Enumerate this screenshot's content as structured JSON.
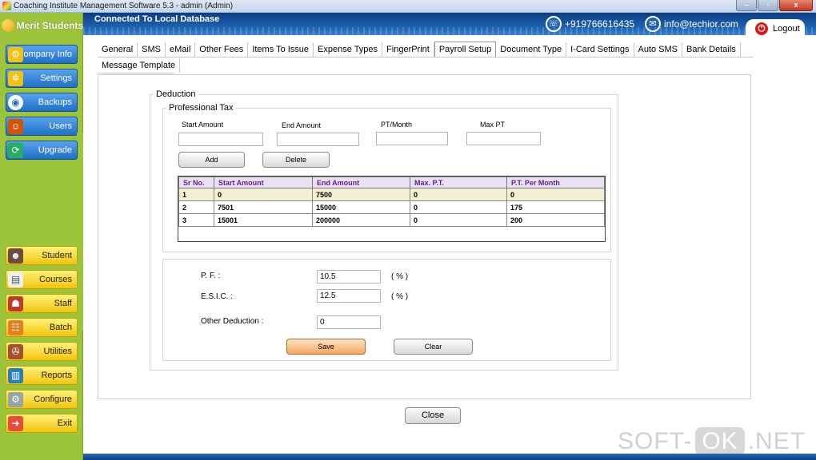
{
  "window": {
    "title": "Coaching Institute Management Software 5.3  -  admin (Admin)",
    "minimize": "–",
    "maximize": "▫",
    "close": "x"
  },
  "header": {
    "db_status": "Connected To  Local Database",
    "phone": "+919766616435",
    "email": "info@techior.com",
    "logout_label": "Logout"
  },
  "sidebar": {
    "brand": "Merit Students",
    "top_items": [
      {
        "label": "Company Info",
        "icon": "gear-icon"
      },
      {
        "label": "Settings",
        "icon": "settings-icon"
      },
      {
        "label": "Backups",
        "icon": "disk-icon"
      },
      {
        "label": "Users",
        "icon": "users-icon"
      },
      {
        "label": "Upgrade",
        "icon": "upgrade-icon"
      }
    ],
    "bottom_items": [
      {
        "label": "Student",
        "icon": "student-icon"
      },
      {
        "label": "Courses",
        "icon": "courses-icon"
      },
      {
        "label": "Staff",
        "icon": "staff-icon"
      },
      {
        "label": "Batch",
        "icon": "batch-icon"
      },
      {
        "label": "Utilities",
        "icon": "utilities-icon"
      },
      {
        "label": "Reports",
        "icon": "reports-icon"
      },
      {
        "label": "Configure",
        "icon": "configure-icon"
      },
      {
        "label": "Exit",
        "icon": "exit-icon"
      }
    ]
  },
  "tabs": {
    "row1": [
      "General",
      "SMS",
      "eMail",
      "Other Fees",
      "Items To Issue",
      "Expense Types",
      "FingerPrint",
      "Payroll Setup",
      "Document Type",
      "I-Card Settings",
      "Auto SMS",
      "Bank Details"
    ],
    "row2": [
      "Message Template"
    ],
    "active": "Payroll Setup"
  },
  "deduction": {
    "legend": "Deduction",
    "professional_tax": {
      "legend": "Professional Tax",
      "start_amount_label": "Start Amount",
      "end_amount_label": "End Amount",
      "pt_month_label": "PT/Month",
      "max_pt_label": "Max PT",
      "start_amount_value": "",
      "end_amount_value": "",
      "pt_month_value": "",
      "max_pt_value": "",
      "add_label": "Add",
      "delete_label": "Delete"
    },
    "table": {
      "columns": [
        "Sr No.",
        "Start Amount",
        "End Amount",
        "Max. P.T.",
        "P.T. Per Month"
      ],
      "rows": [
        [
          "1",
          "0",
          "7500",
          "0",
          "0"
        ],
        [
          "2",
          "7501",
          "15000",
          "0",
          "175"
        ],
        [
          "3",
          "15001",
          "200000",
          "0",
          "200"
        ]
      ]
    },
    "pf_label": "P. F. :",
    "pf_value": "10.5",
    "pf_unit": "( % )",
    "esic_label": "E.S.I.C. :",
    "esic_value": "12.5",
    "esic_unit": "( % )",
    "other_label": "Other Deduction :",
    "other_value": "0",
    "save_label": "Save",
    "clear_label": "Clear"
  },
  "close_label": "Close",
  "watermark": {
    "part1": "SOFT-",
    "part2": "OK",
    "part3": ".NET"
  }
}
